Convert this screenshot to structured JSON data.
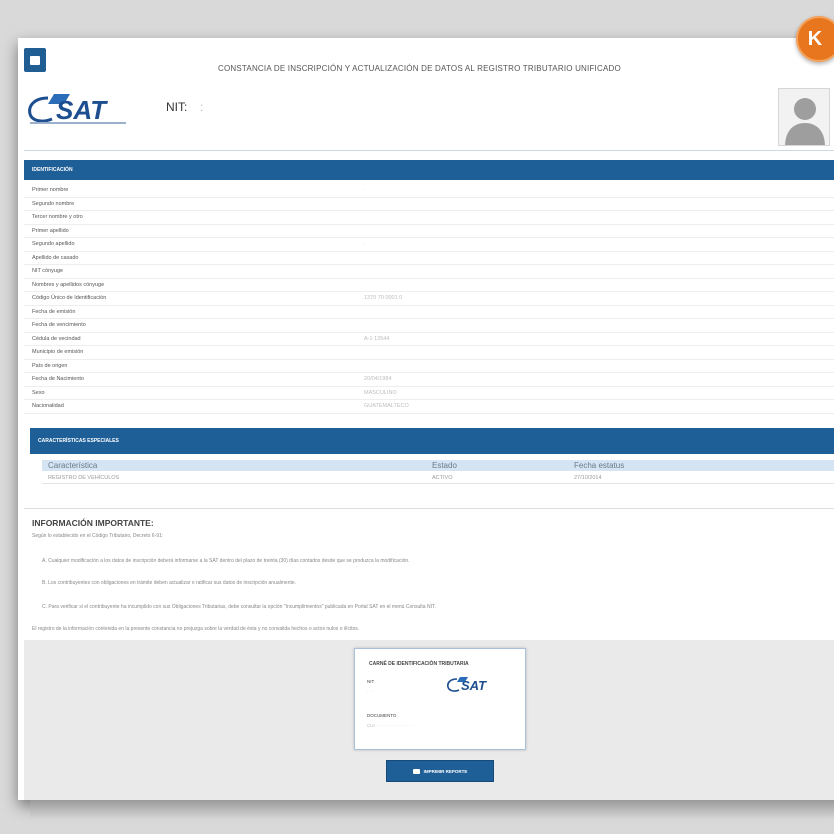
{
  "badge": {
    "letter": "K"
  },
  "header": {
    "title": "CONSTANCIA DE INSCRIPCIÓN Y ACTUALIZACIÓN DE DATOS AL REGISTRO TRIBUTARIO UNIFICADO",
    "logo_text": "SAT",
    "nit_label": "NIT:",
    "nit_value": ":"
  },
  "identificacion": {
    "title": "IDENTIFICACIÓN",
    "rows": [
      {
        "label": "Primer nombre",
        "value": "·"
      },
      {
        "label": "Segundo nombre",
        "value": ""
      },
      {
        "label": "Tercer nombre y otro",
        "value": ""
      },
      {
        "label": "Primer apellido",
        "value": ""
      },
      {
        "label": "Segundo apellido",
        "value": "·"
      },
      {
        "label": "Apellido de casado",
        "value": ""
      },
      {
        "label": "NIT cónyuge",
        "value": ""
      },
      {
        "label": "Nombres y apellidos cónyuge",
        "value": ""
      },
      {
        "label": "Código Único de Identificación",
        "value": "1370 70 0001 0"
      },
      {
        "label": "Fecha de emisión",
        "value": ""
      },
      {
        "label": "Fecha de vencimiento",
        "value": ""
      },
      {
        "label": "Cédula de vecindad",
        "value": "A-1 13544"
      },
      {
        "label": "Municipio de emisión",
        "value": ""
      },
      {
        "label": "País de origen",
        "value": ""
      },
      {
        "label": "Fecha de Nacimiento",
        "value": "20/04/1984"
      },
      {
        "label": "Sexo",
        "value": "MASCULINO"
      },
      {
        "label": "Nacionalidad",
        "value": "GUATEMALTECO"
      }
    ]
  },
  "especiales": {
    "title": "CARACTERÍSTICAS ESPECIALES",
    "columns": [
      "Característica",
      "Estado",
      "Fecha estatus"
    ],
    "rows": [
      [
        "REGISTRO DE VEHÍCULOS",
        "ACTIVO",
        "27/10/2014"
      ]
    ]
  },
  "info": {
    "title": "INFORMACIÓN IMPORTANTE:",
    "intro": "Según lo establecido en el Código Tributario, Decreto 6-91:",
    "a": "A. Cualquier modificación a los datos de inscripción deberá informarse a la SAT dentro del plazo de treinta (30) días contados desde que se produzca la modificación.",
    "b": "B. Los contribuyentes con obligaciones en trámite deben actualizar o ratificar sus datos de inscripción anualmente.",
    "c": "C. Para verificar si el contribuyente ha incumplido con sus Obligaciones Tributarias, debe consultar la opción \"Incumplimientos\" publicada en Portal SAT en el menú Consulta NIT.",
    "footer": "El registro de la información contenida en la presente constancia no prejuzga sobre la verdad de ésta y no convalida hechos o actos nulos o ilícitos."
  },
  "card": {
    "title": "CARNÉ DE IDENTIFICACIÓN TRIBUTARIA",
    "nit_label": "NIT",
    "nit_value": "· · ·",
    "logo_text": "SAT",
    "cui_label": "DOCUMENTO",
    "cui_value": "CUI · · · · · · · · · · · · · ·"
  },
  "actions": {
    "print_label": "IMPRIMIR REPORTE"
  },
  "colors": {
    "primary": "#1f5f98",
    "accent": "#e8761e",
    "header_light": "#d4e4f2"
  }
}
